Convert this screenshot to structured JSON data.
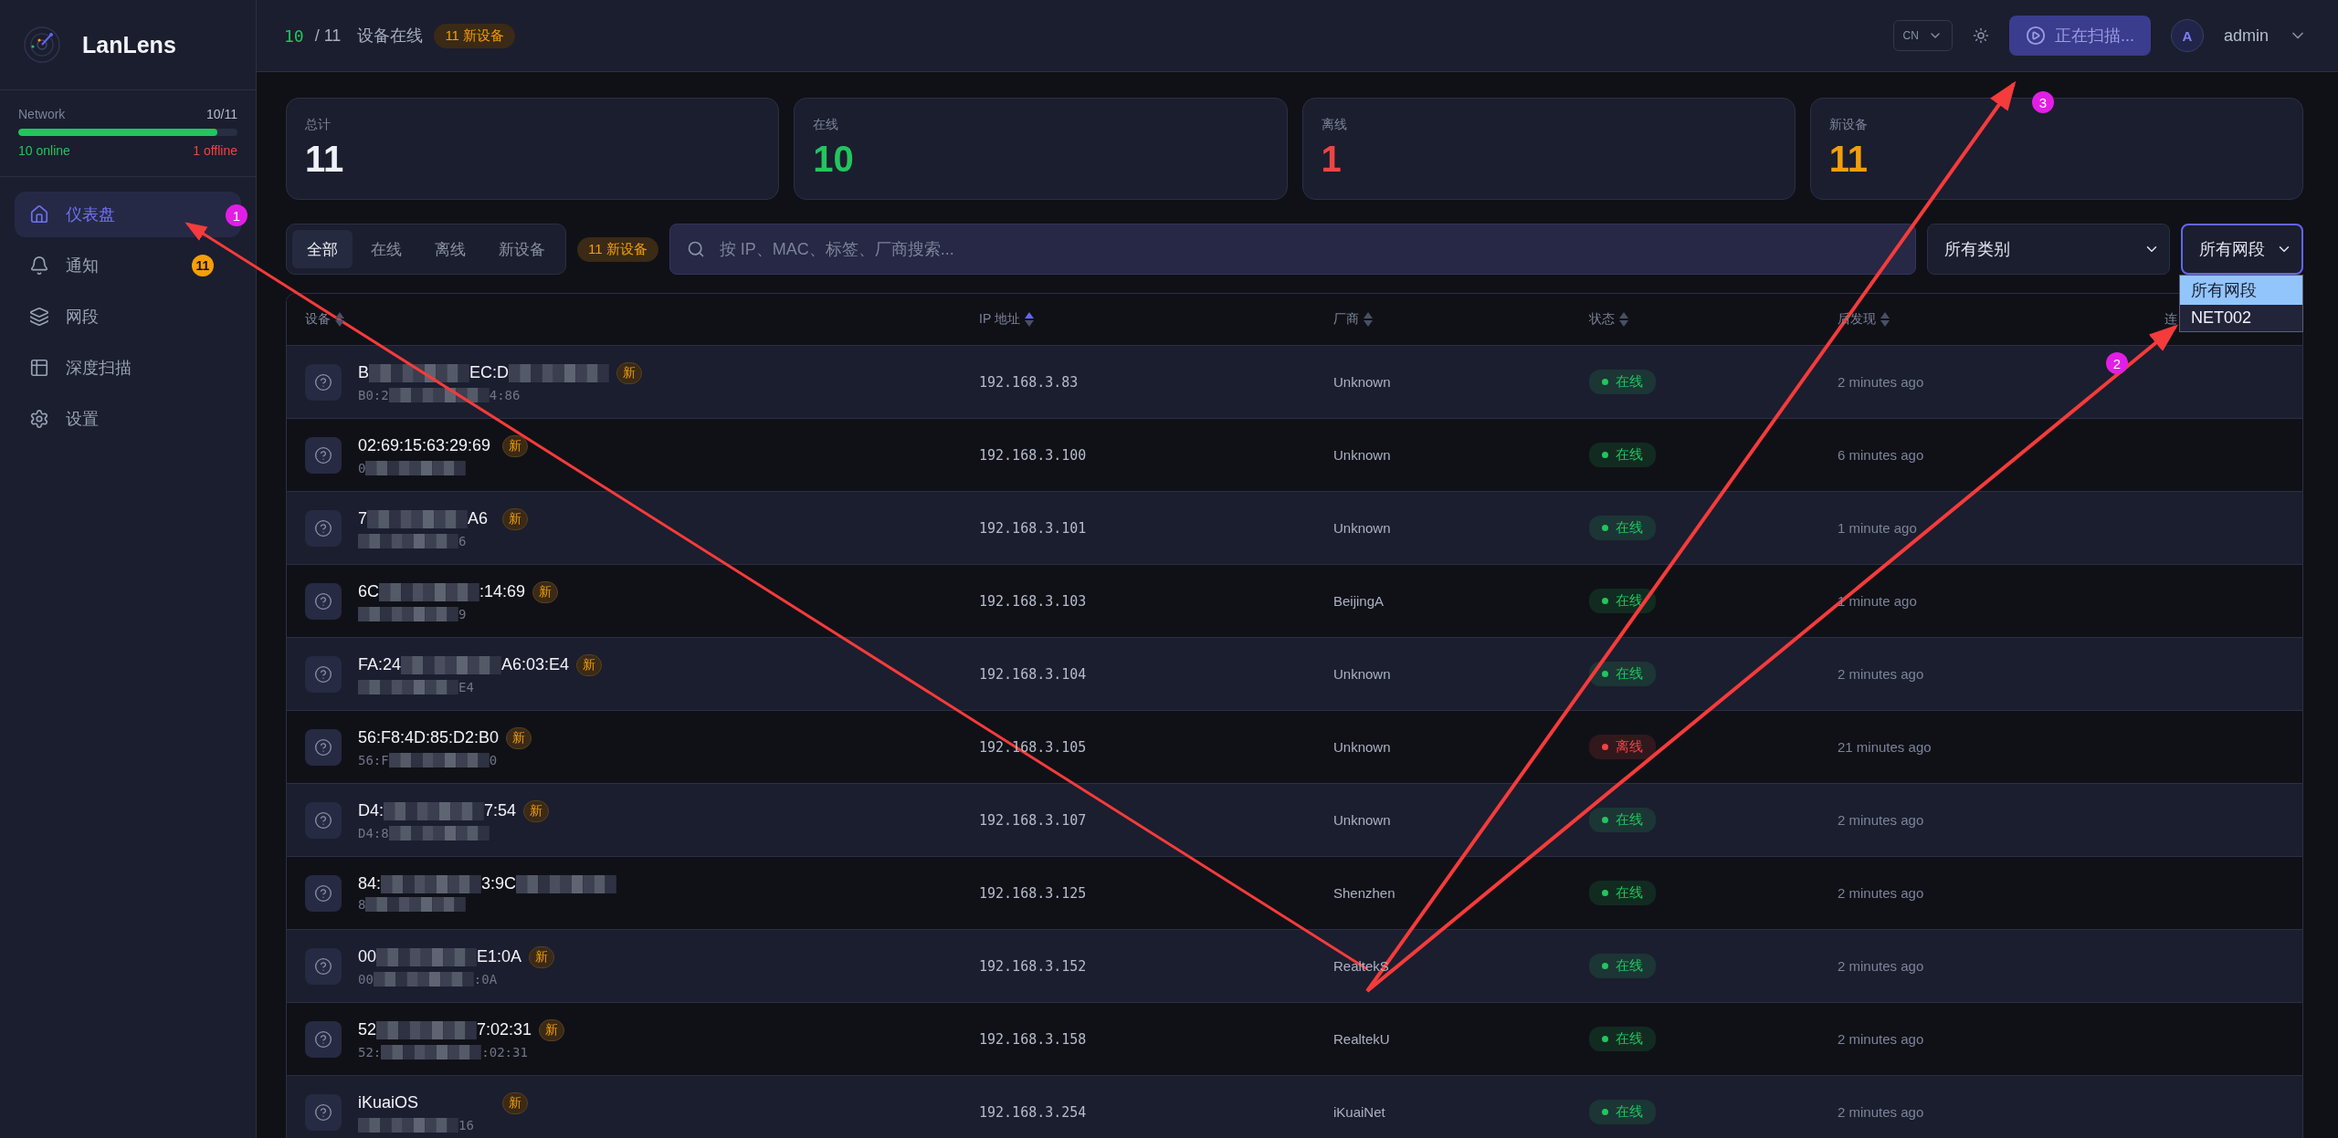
{
  "app": {
    "name": "LanLens"
  },
  "network": {
    "label": "Network",
    "count": "10/11",
    "level": 0.91,
    "online": "10 online",
    "offline": "1 offline"
  },
  "sidebar": {
    "items": [
      {
        "label": "仪表盘",
        "selected": true
      },
      {
        "label": "通知",
        "selected": false,
        "badge": "11"
      },
      {
        "label": "网段",
        "selected": false
      },
      {
        "label": "深度扫描",
        "selected": false
      },
      {
        "label": "设置",
        "selected": false
      }
    ]
  },
  "header": {
    "online": "10",
    "total": "/ 11",
    "online_label": "设备在线",
    "new_badge": "11 新设备",
    "language": "CN",
    "scan_button": "正在扫描...",
    "user_initial": "A",
    "user_name": "admin"
  },
  "stats": [
    {
      "label": "总计",
      "value": "11",
      "color": "#eef1f8"
    },
    {
      "label": "在线",
      "value": "10",
      "color": "#22c55e"
    },
    {
      "label": "离线",
      "value": "1",
      "color": "#ef4444"
    },
    {
      "label": "新设备",
      "value": "11",
      "color": "#f59e0b"
    }
  ],
  "filters": {
    "tabs": [
      {
        "label": "全部",
        "selected": true
      },
      {
        "label": "在线",
        "selected": false
      },
      {
        "label": "离线",
        "selected": false
      },
      {
        "label": "新设备",
        "selected": false
      }
    ],
    "new_badge": "11 新设备",
    "search": {
      "placeholder": "按 IP、MAC、标签、厂商搜索..."
    },
    "category_select": "所有类别",
    "segment_select": "所有网段",
    "segment_options": [
      {
        "label": "所有网段",
        "selected": true
      },
      {
        "label": "NET002",
        "selected": false
      }
    ]
  },
  "table": {
    "columns": [
      {
        "label": "设备",
        "sorted": false,
        "sortable": true
      },
      {
        "label": "IP 地址",
        "sorted": true,
        "sortable": true
      },
      {
        "label": "厂商",
        "sorted": false,
        "sortable": true
      },
      {
        "label": "状态",
        "sorted": false,
        "sortable": true
      },
      {
        "label": "后发现",
        "sorted": false,
        "sortable": true
      },
      {
        "label": "连",
        "sortable": false
      }
    ],
    "rows": [
      {
        "name": [
          {
            "text": "B",
            "blurred_after": true
          },
          {
            "text": "EC:D",
            "blurred_after": true
          }
        ],
        "mac": [
          {
            "text": "B0:2",
            "blurred_after": true
          },
          {
            "text": "4:86",
            "blurred_after": false
          }
        ],
        "new_tag": "新",
        "ip": "192.168.3.83",
        "vendor": "Unknown",
        "color": "#22c55e",
        "status_label": "在线",
        "last_seen": "2 minutes ago"
      },
      {
        "name": [
          {
            "text": "02:69:15:63:29:69",
            "blurred_after": false
          }
        ],
        "mac": [
          {
            "text": "0",
            "blurred_after": true
          }
        ],
        "new_tag": "新",
        "ip": "192.168.3.100",
        "vendor": "Unknown",
        "color": "#22c55e",
        "status_label": "在线",
        "last_seen": "6 minutes ago"
      },
      {
        "name": [
          {
            "text": "7",
            "blurred_after": true
          },
          {
            "text": "A6",
            "blurred_after": false
          }
        ],
        "mac_blurred_start": true,
        "mac": [
          {
            "text": "6",
            "blurred_after": false
          }
        ],
        "new_tag": "新",
        "ip": "192.168.3.101",
        "vendor": "Unknown",
        "color": "#22c55e",
        "status_label": "在线",
        "last_seen": "1 minute ago"
      },
      {
        "name": [
          {
            "text": "6C",
            "blurred_after": true
          },
          {
            "text": ":14:69",
            "blurred_after": false
          }
        ],
        "mac_blurred_start": true,
        "mac": [
          {
            "text": "9",
            "blurred_after": false
          }
        ],
        "new_tag": "新",
        "ip": "192.168.3.103",
        "vendor": "BeijingA",
        "color": "#22c55e",
        "status_label": "在线",
        "last_seen": "1 minute ago"
      },
      {
        "name": [
          {
            "text": "FA:24",
            "blurred_after": true
          },
          {
            "text": "A6:03:E4",
            "blurred_after": false
          }
        ],
        "mac_blurred_start": true,
        "mac": [
          {
            "text": "E4",
            "blurred_after": false
          }
        ],
        "new_tag": "新",
        "ip": "192.168.3.104",
        "vendor": "Unknown",
        "color": "#22c55e",
        "status_label": "在线",
        "last_seen": "2 minutes ago"
      },
      {
        "name": [
          {
            "text": "56:F8:4D:85:D2:B0",
            "blurred_after": false
          }
        ],
        "mac": [
          {
            "text": "56:F",
            "blurred_after": true
          },
          {
            "text": "0",
            "blurred_after": false
          }
        ],
        "new_tag": "新",
        "ip": "192.168.3.105",
        "vendor": "Unknown",
        "color": "#ef4444",
        "status_label": "离线",
        "last_seen": "21 minutes ago"
      },
      {
        "name": [
          {
            "text": "D4:",
            "blurred_after": true
          },
          {
            "text": "7:54",
            "blurred_after": false
          }
        ],
        "mac": [
          {
            "text": "D4:8",
            "blurred_after": true
          }
        ],
        "new_tag": "新",
        "ip": "192.168.3.107",
        "vendor": "Unknown",
        "color": "#22c55e",
        "status_label": "在线",
        "last_seen": "2 minutes ago"
      },
      {
        "name": [
          {
            "text": "84:",
            "blurred_after": true
          },
          {
            "text": "3:9C",
            "blurred_after": true
          }
        ],
        "mac": [
          {
            "text": "8",
            "blurred_after": true
          }
        ],
        "ip": "192.168.3.125",
        "vendor": "Shenzhen",
        "color": "#22c55e",
        "status_label": "在线",
        "last_seen": "2 minutes ago"
      },
      {
        "name": [
          {
            "text": "00",
            "blurred_after": true
          },
          {
            "text": "E1:0A",
            "blurred_after": false
          }
        ],
        "mac": [
          {
            "text": "00",
            "blurred_after": true
          },
          {
            "text": ":0A",
            "blurred_after": false
          }
        ],
        "new_tag": "新",
        "ip": "192.168.3.152",
        "vendor": "RealtekS",
        "color": "#22c55e",
        "status_label": "在线",
        "last_seen": "2 minutes ago"
      },
      {
        "name": [
          {
            "text": "52",
            "blurred_after": true
          },
          {
            "text": "7:02:31",
            "blurred_after": false
          }
        ],
        "mac": [
          {
            "text": "52:",
            "blurred_after": true
          },
          {
            "text": ":02:31",
            "blurred_after": false
          }
        ],
        "new_tag": "新",
        "ip": "192.168.3.158",
        "vendor": "RealtekU",
        "color": "#22c55e",
        "status_label": "在线",
        "last_seen": "2 minutes ago"
      },
      {
        "name": [
          {
            "text": "iKuaiOS",
            "blurred_after": false
          }
        ],
        "mac_blurred_start": true,
        "mac": [
          {
            "text": "16",
            "blurred_after": false
          }
        ],
        "new_tag": "新",
        "ip": "192.168.3.254",
        "vendor": "iKuaiNet",
        "color": "#22c55e",
        "status_label": "在线",
        "last_seen": "2 minutes ago"
      }
    ]
  },
  "callouts": [
    {
      "number": "1"
    },
    {
      "number": "2"
    },
    {
      "number": "3"
    }
  ]
}
